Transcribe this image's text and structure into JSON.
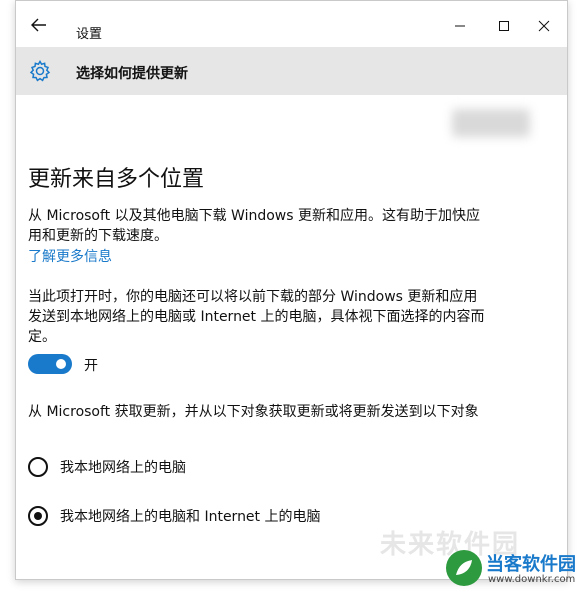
{
  "window": {
    "title": "设置",
    "controls": {
      "minimize": "minimize",
      "maximize": "maximize",
      "close": "close"
    }
  },
  "header": {
    "title": "选择如何提供更新",
    "icon": "gear-icon"
  },
  "main": {
    "heading": "更新来自多个位置",
    "description": "从 Microsoft 以及其他电脑下载 Windows 更新和应用。这有助于加快应用和更新的下载速度。",
    "learn_more": "了解更多信息",
    "toggle_description": "当此项打开时，你的电脑还可以将以前下载的部分 Windows 更新和应用发送到本地网络上的电脑或 Internet 上的电脑，具体视下面选择的内容而定。",
    "toggle_state": "开",
    "toggle_on": true,
    "source_question": "从 Microsoft 获取更新，并从以下对象获取更新或将更新发送到以下对象",
    "options": [
      {
        "label": "我本地网络上的电脑",
        "selected": false
      },
      {
        "label": "我本地网络上的电脑和 Internet 上的电脑",
        "selected": true
      }
    ]
  },
  "watermark": {
    "faint_text": "未来软件园",
    "brand": "当客软件园",
    "url": "www.downkr.com"
  },
  "colors": {
    "accent": "#1979ca",
    "header_band": "#e6e6e6",
    "text": "#111111"
  }
}
